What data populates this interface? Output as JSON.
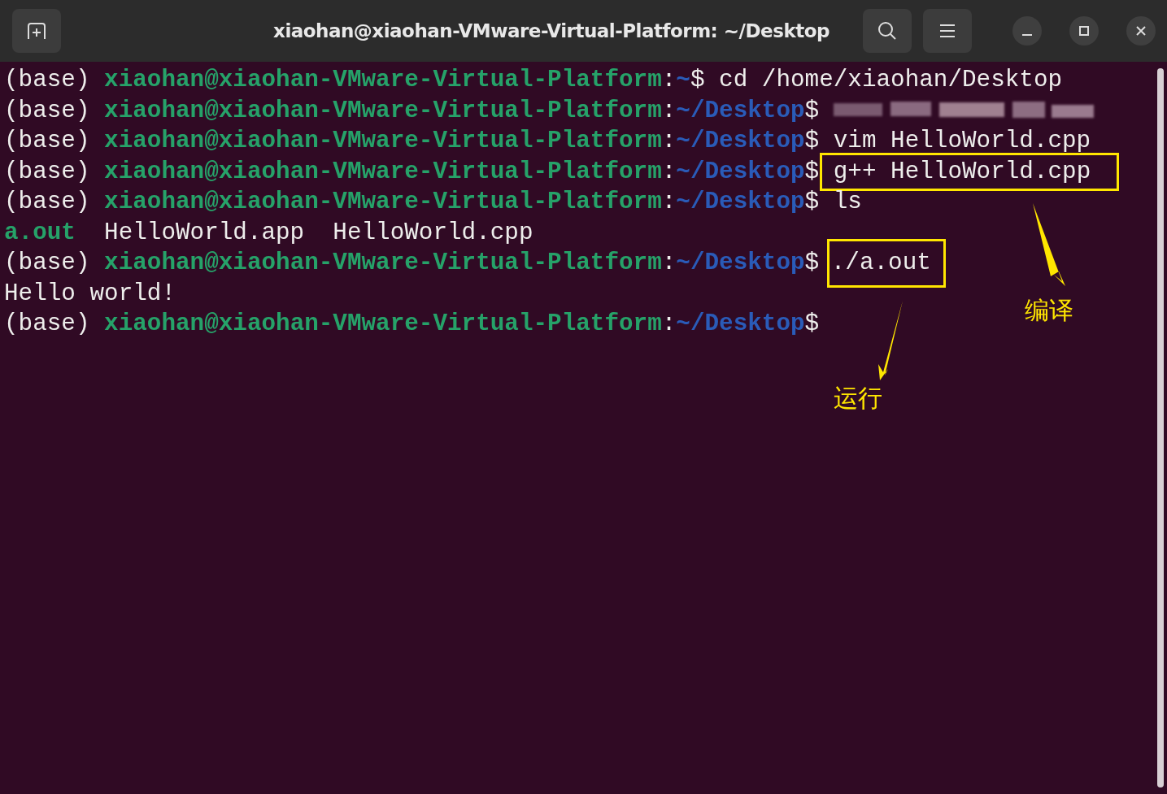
{
  "window": {
    "title": "xiaohan@xiaohan-VMware-Virtual-Platform: ~/Desktop"
  },
  "terminal": {
    "lines": [
      [
        {
          "kind": "env",
          "text": "(base) "
        },
        {
          "kind": "host",
          "text": "xiaohan@xiaohan-VMware-Virtual-Platform"
        },
        {
          "kind": "plain",
          "text": ":"
        },
        {
          "kind": "path",
          "text": "~"
        },
        {
          "kind": "plain",
          "text": "$ cd /home/xiaohan/Desktop"
        }
      ],
      [
        {
          "kind": "env",
          "text": "(base) "
        },
        {
          "kind": "host",
          "text": "xiaohan@xiaohan-VMware-Virtual-Platform"
        },
        {
          "kind": "plain",
          "text": ":"
        },
        {
          "kind": "path",
          "text": "~/Desktop"
        },
        {
          "kind": "plain",
          "text": "$ "
        },
        {
          "kind": "redacted"
        }
      ],
      [
        {
          "kind": "env",
          "text": "(base) "
        },
        {
          "kind": "host",
          "text": "xiaohan@xiaohan-VMware-Virtual-Platform"
        },
        {
          "kind": "plain",
          "text": ":"
        },
        {
          "kind": "path",
          "text": "~/Desktop"
        },
        {
          "kind": "plain",
          "text": "$ vim HelloWorld.cpp"
        }
      ],
      [
        {
          "kind": "env",
          "text": "(base) "
        },
        {
          "kind": "host",
          "text": "xiaohan@xiaohan-VMware-Virtual-Platform"
        },
        {
          "kind": "plain",
          "text": ":"
        },
        {
          "kind": "path",
          "text": "~/Desktop"
        },
        {
          "kind": "plain",
          "text": "$"
        },
        {
          "kind": "cmd",
          "text": "g++ HelloWorld.cpp",
          "highlighted": true
        }
      ],
      [
        {
          "kind": "env",
          "text": "(base) "
        },
        {
          "kind": "host",
          "text": "xiaohan@xiaohan-VMware-Virtual-Platform"
        },
        {
          "kind": "plain",
          "text": ":"
        },
        {
          "kind": "path",
          "text": "~/Desktop"
        },
        {
          "kind": "plain",
          "text": "$ ls"
        }
      ],
      [
        {
          "kind": "exec",
          "text": "a.out"
        },
        {
          "kind": "plain",
          "text": "  HelloWorld.app  HelloWorld.cpp"
        }
      ],
      [
        {
          "kind": "env",
          "text": "(base) "
        },
        {
          "kind": "host",
          "text": "xiaohan@xiaohan-VMware-Virtual-Platform"
        },
        {
          "kind": "plain",
          "text": ":"
        },
        {
          "kind": "path",
          "text": "~/Desktop"
        },
        {
          "kind": "plain",
          "text": "$"
        },
        {
          "kind": "cmd",
          "text": "./a.out",
          "highlighted": true
        }
      ],
      [
        {
          "kind": "plain",
          "text": "Hello world!"
        }
      ],
      [
        {
          "kind": "env",
          "text": "(base) "
        },
        {
          "kind": "host",
          "text": "xiaohan@xiaohan-VMware-Virtual-Platform"
        },
        {
          "kind": "plain",
          "text": ":"
        },
        {
          "kind": "path",
          "text": "~/Desktop"
        },
        {
          "kind": "plain",
          "text": "$"
        }
      ]
    ]
  },
  "annotations": [
    {
      "label": "编译"
    },
    {
      "label": "运行"
    }
  ]
}
